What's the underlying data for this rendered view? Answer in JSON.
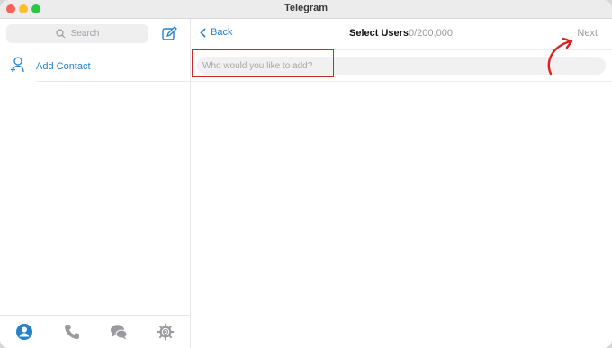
{
  "window": {
    "title": "Telegram"
  },
  "sidebar": {
    "search_placeholder": "Search",
    "add_contact_label": "Add Contact"
  },
  "tabs": [
    "contacts",
    "calls",
    "chats",
    "settings"
  ],
  "header": {
    "back_label": "Back",
    "title": "Select Users",
    "count": "0/200,000",
    "next_label": "Next"
  },
  "add_users": {
    "placeholder": "Who would you like to add?",
    "value": ""
  },
  "colors": {
    "accent": "#2481cc",
    "annotation": "#c8282f"
  },
  "icons": {
    "search": "search-icon",
    "compose": "compose-icon",
    "add_contact": "add-contact-icon",
    "back": "chevron-left-icon",
    "contacts_tab": "person-icon",
    "calls_tab": "phone-icon",
    "chats_tab": "chat-bubbles-icon",
    "settings_tab": "gear-icon"
  }
}
